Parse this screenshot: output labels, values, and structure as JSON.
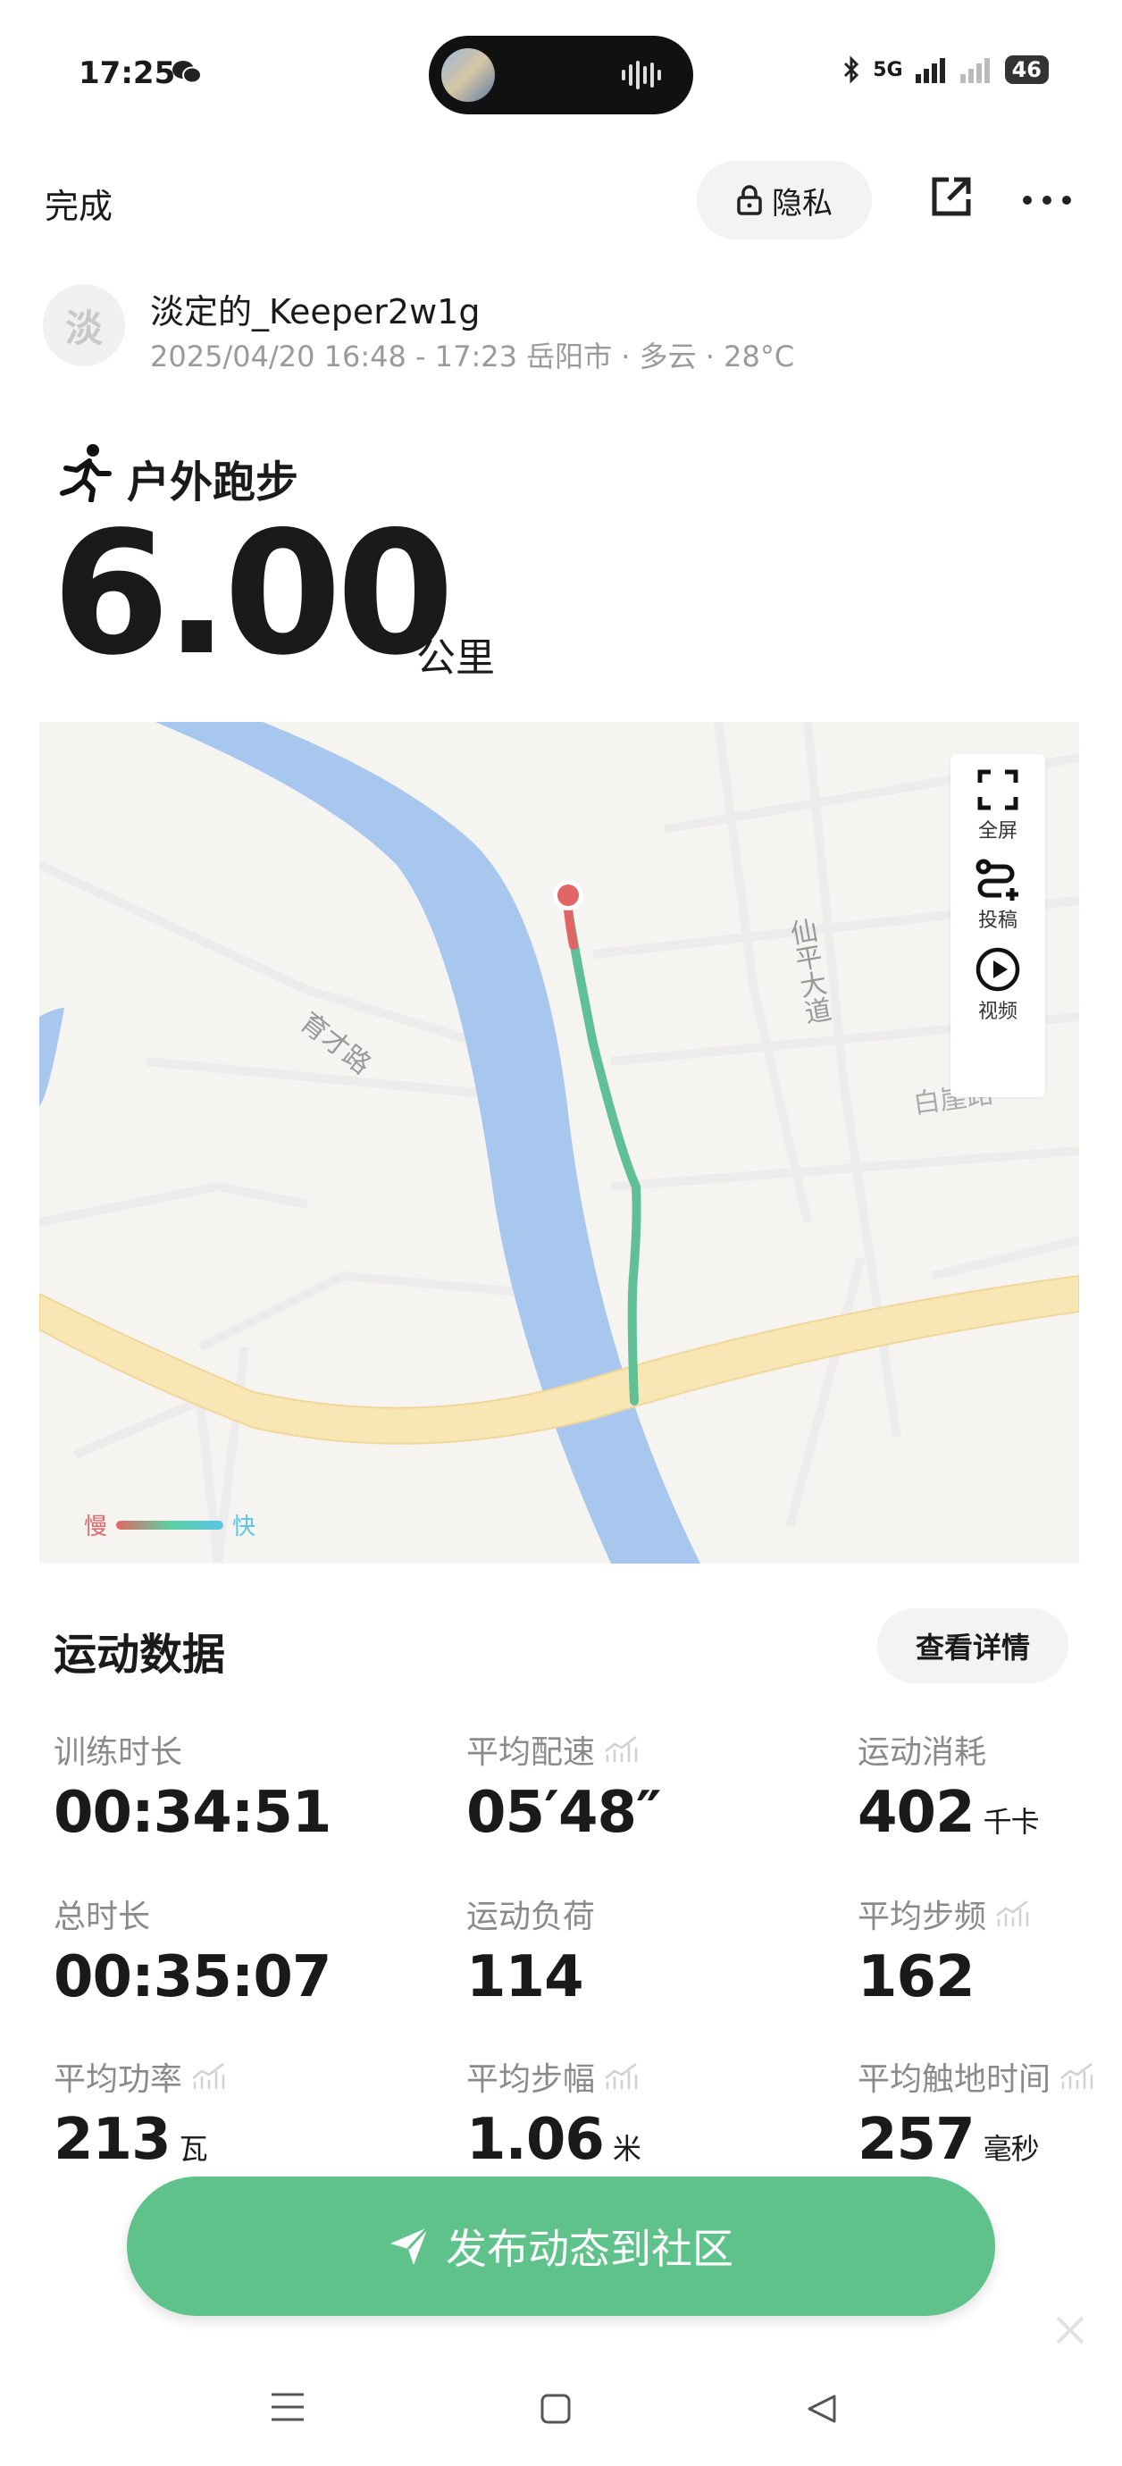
{
  "status_bar": {
    "time": "17:25",
    "network": "5G",
    "battery": "46"
  },
  "header": {
    "done_label": "完成",
    "privacy_label": "隐私"
  },
  "user": {
    "avatar_initial": "淡",
    "name": "淡定的_Keeper2w1g",
    "meta": "2025/04/20 16:48 - 17:23 岳阳市 · 多云 · 28°C"
  },
  "workout": {
    "type": "户外跑步",
    "distance": "6.00",
    "distance_unit": "公里"
  },
  "map": {
    "controls": {
      "fullscreen": "全屏",
      "cast": "投稿",
      "video": "视频"
    },
    "labels": {
      "road_yucai": "育才路",
      "road_xianping": "仙平大道",
      "road_baisha": "白崖路"
    },
    "legend": {
      "slow": "慢",
      "fast": "快"
    },
    "colors": {
      "slow": "#e06666",
      "fast": "#59c6e8",
      "river": "#a8c7ee",
      "road": "#f8e7b5"
    }
  },
  "stats": {
    "title": "运动数据",
    "details_label": "查看详情",
    "items": [
      {
        "label": "训练时长",
        "value": "00:34:51",
        "unit": ""
      },
      {
        "label": "平均配速",
        "value": "05′48″",
        "unit": ""
      },
      {
        "label": "运动消耗",
        "value": "402",
        "unit": "千卡"
      },
      {
        "label": "总时长",
        "value": "00:35:07",
        "unit": ""
      },
      {
        "label": "运动负荷",
        "value": "114",
        "unit": ""
      },
      {
        "label": "平均步频",
        "value": "162",
        "unit": ""
      },
      {
        "label": "平均功率",
        "value": "213",
        "unit": "瓦"
      },
      {
        "label": "平均步幅",
        "value": "1.06",
        "unit": "米"
      },
      {
        "label": "平均触地时间",
        "value": "257",
        "unit": "毫秒"
      }
    ]
  },
  "cta": {
    "label": "发布动态到社区",
    "color": "#5fc28a"
  }
}
